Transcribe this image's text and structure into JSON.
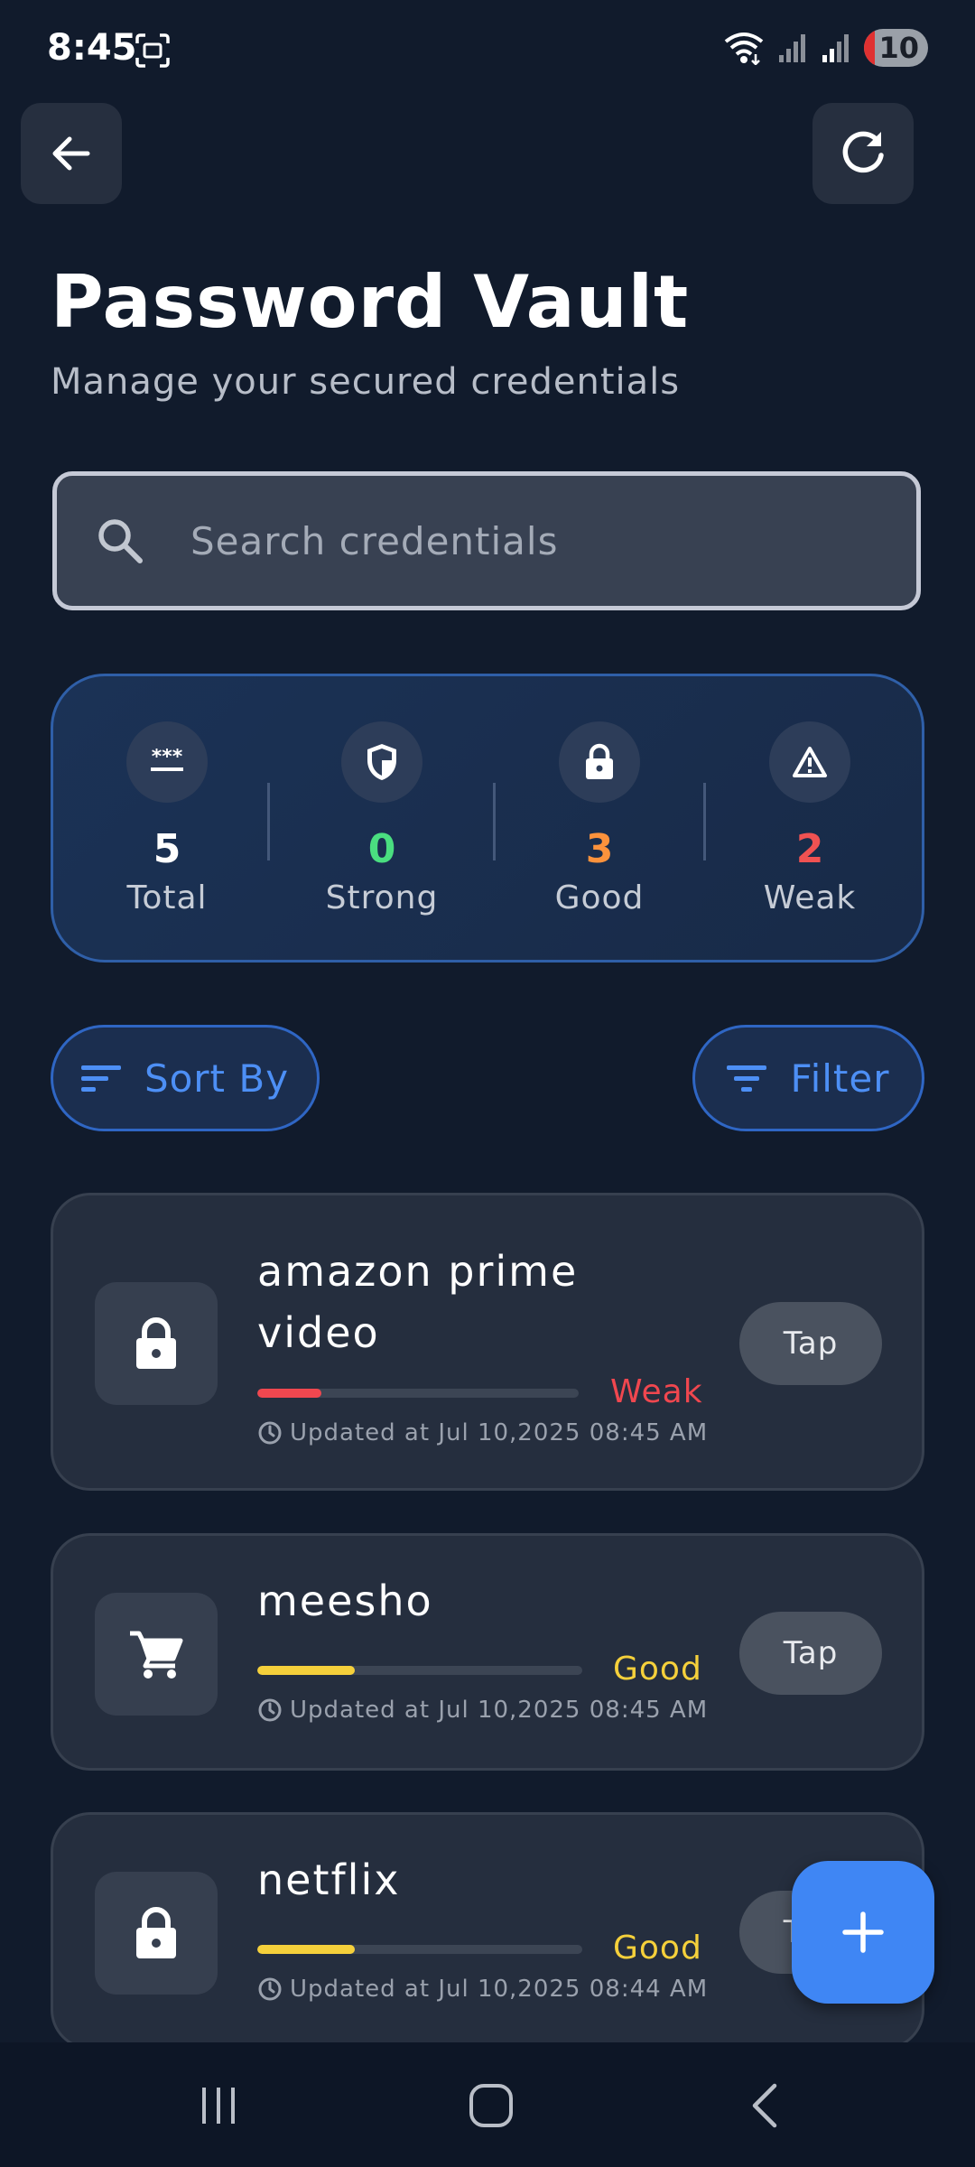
{
  "status_bar": {
    "time": "8:45",
    "battery": "10",
    "icons": [
      "screenshot-icon",
      "wifi-icon",
      "signal-icon",
      "signal-icon",
      "battery-icon"
    ]
  },
  "header": {
    "title": "Password Vault",
    "subtitle": "Manage your secured credentials"
  },
  "search": {
    "placeholder": "Search credentials",
    "value": ""
  },
  "stats": [
    {
      "value": "5",
      "label": "Total",
      "color": "#ffffff",
      "icon": "password-dots-icon"
    },
    {
      "value": "0",
      "label": "Strong",
      "color": "#4ade80",
      "icon": "shield-icon"
    },
    {
      "value": "3",
      "label": "Good",
      "color": "#fb923c",
      "icon": "lock-icon"
    },
    {
      "value": "2",
      "label": "Weak",
      "color": "#f05252",
      "icon": "warning-icon"
    }
  ],
  "actions": {
    "sort_label": "Sort By",
    "filter_label": "Filter"
  },
  "credentials": [
    {
      "name": "amazon prime video",
      "strength": "Weak",
      "strength_fraction": 0.2,
      "color": "#f0474f",
      "updated": "Updated at Jul 10,2025 08:45 AM",
      "tap": "Tap",
      "icon": "lock-icon"
    },
    {
      "name": "meesho",
      "strength": "Good",
      "strength_fraction": 0.3,
      "color": "#f5d03b",
      "updated": "Updated at Jul 10,2025 08:45 AM",
      "tap": "Tap",
      "icon": "cart-icon"
    },
    {
      "name": "netflix",
      "strength": "Good",
      "strength_fraction": 0.3,
      "color": "#f5d03b",
      "updated": "Updated at Jul 10,2025 08:44 AM",
      "tap": "Tap",
      "icon": "lock-icon"
    }
  ],
  "colors": {
    "background": "#111b2c",
    "accent": "#3f86f4"
  }
}
